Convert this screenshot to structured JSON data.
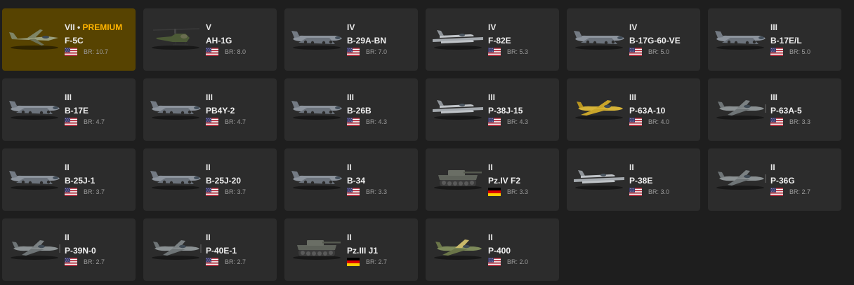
{
  "colors": {
    "background": "#1e1e1e",
    "card": "#2c2c2c",
    "card_premium": "#574301",
    "premium_text": "#ffb400",
    "br_text": "#9c9c9c"
  },
  "vehicles": [
    {
      "rank": "VII",
      "premium": true,
      "premium_label": "PREMIUM",
      "name": "F-5C",
      "country": "usa",
      "br": "BR: 10.7",
      "icon": "jet-icon"
    },
    {
      "rank": "V",
      "premium": false,
      "name": "AH-1G",
      "country": "usa",
      "br": "BR: 8.0",
      "icon": "helicopter-icon"
    },
    {
      "rank": "IV",
      "premium": false,
      "name": "B-29A-BN",
      "country": "usa",
      "br": "BR: 7.0",
      "icon": "bomber-icon"
    },
    {
      "rank": "IV",
      "premium": false,
      "name": "F-82E",
      "country": "usa",
      "br": "BR: 5.3",
      "icon": "twin-fighter-icon"
    },
    {
      "rank": "IV",
      "premium": false,
      "name": "B-17G-60-VE",
      "country": "usa",
      "br": "BR: 5.0",
      "icon": "bomber-icon"
    },
    {
      "rank": "III",
      "premium": false,
      "name": "B-17E/L",
      "country": "usa",
      "br": "BR: 5.0",
      "icon": "bomber-icon"
    },
    {
      "rank": "III",
      "premium": false,
      "name": "B-17E",
      "country": "usa",
      "br": "BR: 4.7",
      "icon": "bomber-icon"
    },
    {
      "rank": "III",
      "premium": false,
      "name": "PB4Y-2",
      "country": "usa",
      "br": "BR: 4.7",
      "icon": "bomber-icon"
    },
    {
      "rank": "III",
      "premium": false,
      "name": "B-26B",
      "country": "usa",
      "br": "BR: 4.3",
      "icon": "bomber-icon"
    },
    {
      "rank": "III",
      "premium": false,
      "name": "P-38J-15",
      "country": "usa",
      "br": "BR: 4.3",
      "icon": "twin-fighter-icon"
    },
    {
      "rank": "III",
      "premium": false,
      "name": "P-63A-10",
      "country": "usa",
      "br": "BR: 4.0",
      "icon": "fighter-yellow-icon"
    },
    {
      "rank": "III",
      "premium": false,
      "name": "P-63A-5",
      "country": "usa",
      "br": "BR: 3.3",
      "icon": "fighter-icon"
    },
    {
      "rank": "II",
      "premium": false,
      "name": "B-25J-1",
      "country": "usa",
      "br": "BR: 3.7",
      "icon": "bomber-icon"
    },
    {
      "rank": "II",
      "premium": false,
      "name": "B-25J-20",
      "country": "usa",
      "br": "BR: 3.7",
      "icon": "bomber-icon"
    },
    {
      "rank": "II",
      "premium": false,
      "name": "B-34",
      "country": "usa",
      "br": "BR: 3.3",
      "icon": "bomber-icon"
    },
    {
      "rank": "II",
      "premium": false,
      "name": "Pz.IV F2",
      "country": "germany",
      "br": "BR: 3.3",
      "icon": "tank-icon"
    },
    {
      "rank": "II",
      "premium": false,
      "name": "P-38E",
      "country": "usa",
      "br": "BR: 3.0",
      "icon": "twin-fighter-icon"
    },
    {
      "rank": "II",
      "premium": false,
      "name": "P-36G",
      "country": "usa",
      "br": "BR: 2.7",
      "icon": "fighter-icon"
    },
    {
      "rank": "II",
      "premium": false,
      "name": "P-39N-0",
      "country": "usa",
      "br": "BR: 2.7",
      "icon": "fighter-icon"
    },
    {
      "rank": "II",
      "premium": false,
      "name": "P-40E-1",
      "country": "usa",
      "br": "BR: 2.7",
      "icon": "fighter-icon"
    },
    {
      "rank": "II",
      "premium": false,
      "name": "Pz.III J1",
      "country": "germany",
      "br": "BR: 2.7",
      "icon": "tank-icon"
    },
    {
      "rank": "II",
      "premium": false,
      "name": "P-400",
      "country": "usa",
      "br": "BR: 2.0",
      "icon": "fighter-green-icon"
    }
  ]
}
